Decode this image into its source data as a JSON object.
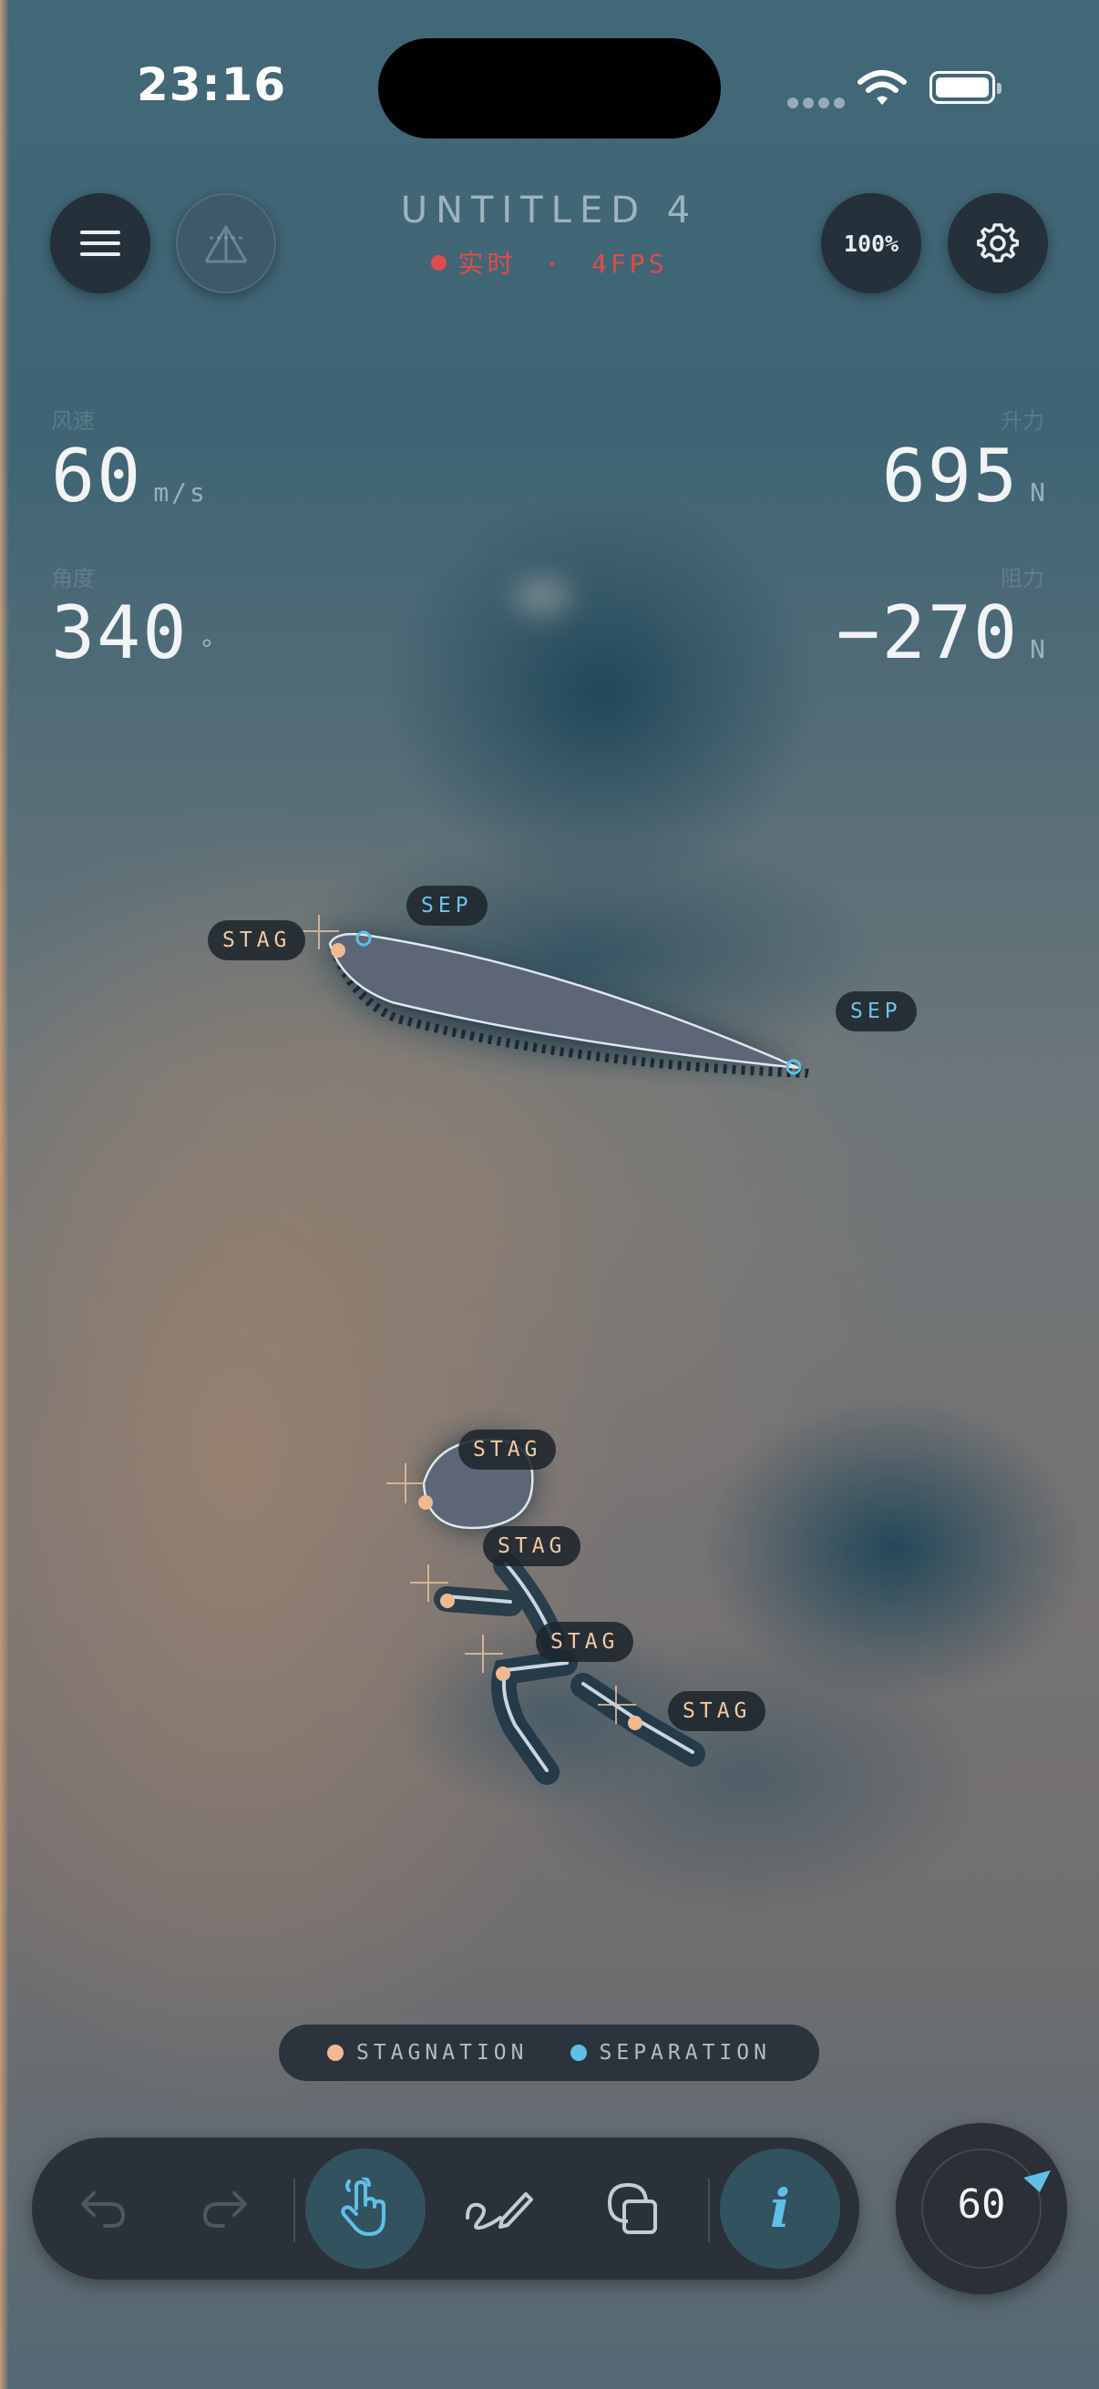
{
  "status_bar": {
    "time": "23:16"
  },
  "header": {
    "title": "UNTITLED 4",
    "status_mode": "实时",
    "status_separator": "·",
    "status_fps": "4FPS",
    "zoom": "100%"
  },
  "readouts": {
    "wind": {
      "label": "风速",
      "value": "60",
      "unit": "m/s"
    },
    "angle": {
      "label": "角度",
      "value": "340",
      "unit": "°"
    },
    "lift": {
      "label": "升力",
      "value": "695",
      "unit": "N"
    },
    "drag": {
      "label": "阻力",
      "value": "−270",
      "unit": "N"
    }
  },
  "markers": {
    "stag": "STAG",
    "sep": "SEP"
  },
  "legend": {
    "stagnation": "STAGNATION",
    "separation": "SEPARATION"
  },
  "dial": {
    "value": "60"
  },
  "colors": {
    "stagnation": "#f0b98f",
    "separation": "#5ec0e8",
    "accent": "#5ec0e8",
    "status_live": "#e04b4b"
  },
  "icons": {
    "menu": "menu-icon",
    "airfoil": "airfoil-icon",
    "settings": "gear-icon",
    "undo": "undo-icon",
    "redo": "redo-icon",
    "pointer": "hand-pointer-icon",
    "draw": "draw-pen-icon",
    "shapes": "shapes-icon",
    "info": "info-icon"
  }
}
